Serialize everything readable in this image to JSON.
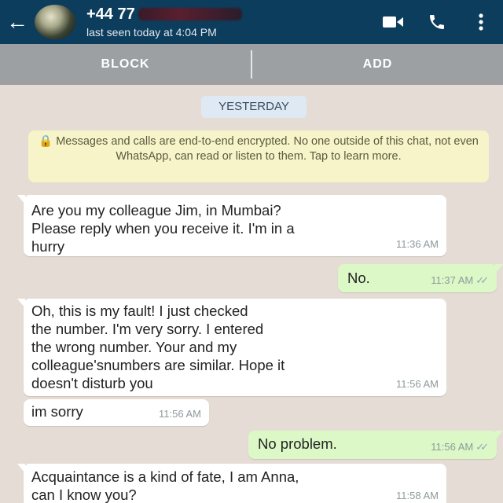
{
  "header": {
    "back_icon": "arrow-left-icon",
    "contact_name": "+44 77",
    "status": "last seen today at 4:04 PM",
    "icons": [
      "video-call-icon",
      "phone-icon",
      "more-vert-icon"
    ]
  },
  "actions": {
    "block_label": "BLOCK",
    "add_label": "ADD"
  },
  "chat": {
    "date_label": "YESTERDAY",
    "encryption_notice": "Messages and calls are end-to-end encrypted. No one outside of this chat, not even WhatsApp, can read or listen to them. Tap to learn more.",
    "messages": [
      {
        "direction": "in",
        "text": "Are you my colleague Jim, in Mumbai?\nPlease reply when you receive it. I'm in a\nhurry",
        "time": "11:36 AM"
      },
      {
        "direction": "out",
        "text": "No.",
        "time": "11:37 AM"
      },
      {
        "direction": "in",
        "text": "Oh, this is my fault! I just checked\nthe number. I'm very sorry. I entered\nthe wrong number. Your and my\ncolleague'snumbers are similar. Hope it\ndoesn't disturb you",
        "time": "11:56 AM"
      },
      {
        "direction": "in",
        "text": "im sorry",
        "time": "11:56 AM"
      },
      {
        "direction": "out",
        "text": "No problem.",
        "time": "11:56 AM"
      },
      {
        "direction": "in",
        "text": "Acquaintance is a kind of fate, I am Anna,\ncan I know you?",
        "time": "11:58 AM"
      }
    ]
  },
  "colors": {
    "header": "#0d3d5c",
    "incoming_bubble": "#ffffff",
    "outgoing_bubble": "#dcf8c6",
    "chat_background": "#e5ddd5",
    "notice_background": "#f7f4c9"
  }
}
